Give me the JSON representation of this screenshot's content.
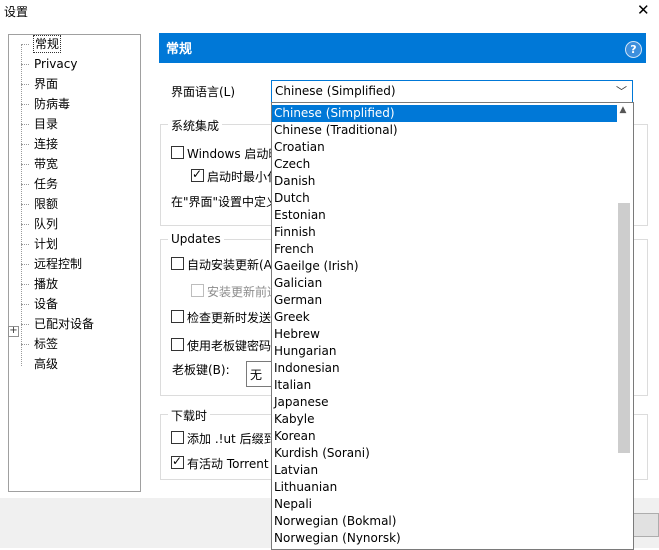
{
  "window": {
    "title": "设置",
    "close_icon": "close-icon"
  },
  "tree": {
    "items": [
      {
        "label": "常规"
      },
      {
        "label": "Privacy"
      },
      {
        "label": "界面"
      },
      {
        "label": "防病毒"
      },
      {
        "label": "目录"
      },
      {
        "label": "连接"
      },
      {
        "label": "带宽"
      },
      {
        "label": "任务"
      },
      {
        "label": "限额"
      },
      {
        "label": "队列"
      },
      {
        "label": "计划"
      },
      {
        "label": "远程控制"
      },
      {
        "label": "播放"
      },
      {
        "label": "设备"
      },
      {
        "label": "已配对设备"
      },
      {
        "label": "标签"
      },
      {
        "label": "高级"
      }
    ],
    "selected": "常规"
  },
  "header": {
    "title": "常规",
    "help_icon": "help-icon"
  },
  "language": {
    "label": "界面语言(L)",
    "value": "Chinese (Simplified)"
  },
  "system_integration": {
    "title": "系统集成",
    "windows_startup": "Windows 启动时",
    "start_minimized": "启动时最小化",
    "interface_hint": "在\"界面\"设置中定义"
  },
  "updates": {
    "title": "Updates",
    "auto_install": "自动安装更新(A",
    "install_notify": "安装更新前通",
    "check_send": "检查更新时发送",
    "boss_key_password": "使用老板键密码",
    "boss_key_label": "老板键(B):",
    "boss_key_value": "无"
  },
  "downloading": {
    "title": "下载时",
    "add_lut": "添加 .!ut 后缀到",
    "active_torrent": "有活动 Torrent"
  },
  "dropdown": {
    "options": [
      "Chinese (Simplified)",
      "Chinese (Traditional)",
      "Croatian",
      "Czech",
      "Danish",
      "Dutch",
      "Estonian",
      "Finnish",
      "French",
      "Gaeilge (Irish)",
      "Galician",
      "German",
      "Greek",
      "Hebrew",
      "Hungarian",
      "Indonesian",
      "Italian",
      "Japanese",
      "Kabyle",
      "Korean",
      "Kurdish (Sorani)",
      "Latvian",
      "Lithuanian",
      "Nepali",
      "Norwegian (Bokmal)",
      "Norwegian (Nynorsk)"
    ],
    "selected": "Chinese (Simplified)"
  }
}
